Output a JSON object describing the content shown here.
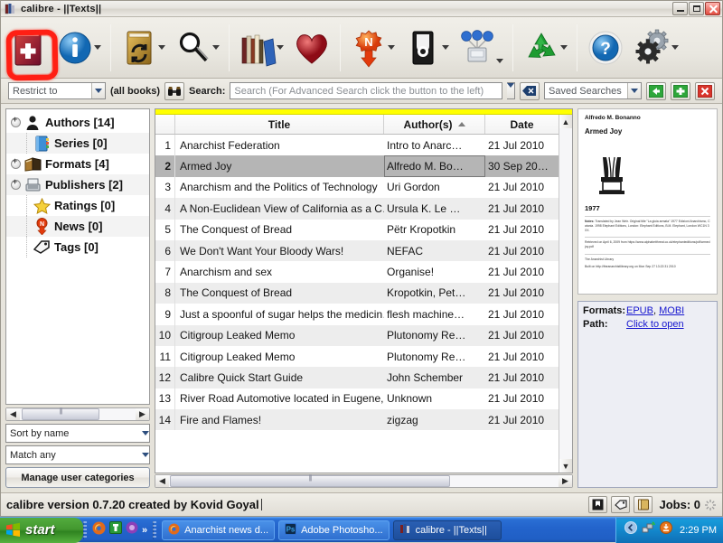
{
  "window": {
    "title": "calibre - ||Texts||",
    "icon": "calibre-books-icon",
    "controls": {
      "minimize": "Minimize",
      "restore": "Restore",
      "close": "Close"
    }
  },
  "toolbar": {
    "items": [
      {
        "name": "add-books-button",
        "icon": "book-plus-icon",
        "label": "Add books",
        "has_menu": false,
        "highlighted": true
      },
      {
        "name": "edit-metadata-button",
        "icon": "info-circle-icon",
        "label": "Edit metadata",
        "has_menu": true
      },
      {
        "name": "convert-books-button",
        "icon": "book-convert-icon",
        "label": "Convert books",
        "has_menu": true
      },
      {
        "name": "view-button",
        "icon": "magnifier-icon",
        "label": "View",
        "has_menu": true
      },
      {
        "name": "get-books-button",
        "icon": "bookshelf-icon",
        "label": "Get books",
        "has_menu": true
      },
      {
        "name": "donate-button",
        "icon": "heart-icon",
        "label": "Donate",
        "has_menu": false
      },
      {
        "name": "fetch-news-button",
        "icon": "news-pin-icon",
        "label": "Fetch news",
        "has_menu": true
      },
      {
        "name": "save-to-disk-button",
        "icon": "hard-disk-icon",
        "label": "Save to disk",
        "has_menu": true
      },
      {
        "name": "connect-share-button",
        "icon": "connect-share-icon",
        "label": "Connect/share",
        "has_menu": true
      },
      {
        "name": "remove-books-button",
        "icon": "recycle-icon",
        "label": "Remove books",
        "has_menu": true
      },
      {
        "name": "help-button",
        "icon": "question-circle-icon",
        "label": "Help",
        "has_menu": false
      },
      {
        "name": "preferences-button",
        "icon": "gears-icon",
        "label": "Preferences",
        "has_menu": true
      }
    ],
    "highlight_color": "#ff1f14"
  },
  "searchbar": {
    "restrict_label": "Restrict to",
    "restrict_value": "Restrict to",
    "all_books_label": "(all books)",
    "advanced_search_icon": "binoculars-icon",
    "search_label": "Search:",
    "search_value": "",
    "search_placeholder": "Search (For Advanced Search click the button to the left)",
    "clear_icon": "clear-search-icon",
    "saved_searches_value": "Saved Searches",
    "copy_search_icon": "green-left-arrow-icon",
    "add_search_icon": "green-plus-icon",
    "delete_search_icon": "red-x-icon"
  },
  "sidebar": {
    "items": [
      {
        "label": "Authors [14]",
        "icon": "person-icon",
        "expandable": true
      },
      {
        "label": "Series [0]",
        "icon": "notebook-icon",
        "expandable": false
      },
      {
        "label": "Formats [4]",
        "icon": "open-book-icon",
        "expandable": true
      },
      {
        "label": "Publishers [2]",
        "icon": "typewriter-icon",
        "expandable": true
      },
      {
        "label": "Ratings [0]",
        "icon": "star-icon",
        "expandable": false
      },
      {
        "label": "News [0]",
        "icon": "news-pin-icon",
        "expandable": false
      },
      {
        "label": "Tags [0]",
        "icon": "tag-icon",
        "expandable": false
      }
    ],
    "sort_value": "Sort by name",
    "match_value": "Match any",
    "manage_button": "Manage user categories"
  },
  "book_list": {
    "columns": [
      {
        "key": "num",
        "label": ""
      },
      {
        "key": "title",
        "label": "Title"
      },
      {
        "key": "author",
        "label": "Author(s)",
        "sorted": true,
        "sort_dir": "asc"
      },
      {
        "key": "date",
        "label": "Date"
      }
    ],
    "rows": [
      {
        "num": "1",
        "title": "Anarchist Federation",
        "author": "Intro to Anarc…",
        "date": "21 Jul 2010"
      },
      {
        "num": "2",
        "title": "Armed Joy",
        "author": "Alfredo M. Bo…",
        "date": "30 Sep 20…",
        "selected": true
      },
      {
        "num": "3",
        "title": "Anarchism and the Politics of Technology",
        "author": "Uri Gordon",
        "date": "21 Jul 2010"
      },
      {
        "num": "4",
        "title": "A Non-Euclidean View of California as a C…",
        "author": "Ursula K. Le …",
        "date": "21 Jul 2010"
      },
      {
        "num": "5",
        "title": "The Conquest of Bread",
        "author": "Pëtr Kropotkin",
        "date": "21 Jul 2010"
      },
      {
        "num": "6",
        "title": "We Don't Want Your Bloody Wars!",
        "author": "NEFAC",
        "date": "21 Jul 2010"
      },
      {
        "num": "7",
        "title": "Anarchism and sex",
        "author": "Organise!",
        "date": "21 Jul 2010"
      },
      {
        "num": "8",
        "title": "The Conquest of Bread",
        "author": "Kropotkin, Pet…",
        "date": "21 Jul 2010"
      },
      {
        "num": "9",
        "title": "Just a spoonful of sugar helps the medicin…",
        "author": "flesh machine…",
        "date": "21 Jul 2010"
      },
      {
        "num": "10",
        "title": "Citigroup Leaked Memo",
        "author": "Plutonomy Re…",
        "date": "21 Jul 2010"
      },
      {
        "num": "11",
        "title": "Citigroup Leaked Memo",
        "author": "Plutonomy Re…",
        "date": "21 Jul 2010"
      },
      {
        "num": "12",
        "title": "Calibre Quick Start Guide",
        "author": "John Schember",
        "date": "21 Jul 2010"
      },
      {
        "num": "13",
        "title": "River Road Automotive located in Eugene, …",
        "author": "Unknown",
        "date": "21 Jul 2010"
      },
      {
        "num": "14",
        "title": "Fire and Flames!",
        "author": "zigzag",
        "date": "21 Jul 2010"
      }
    ]
  },
  "details": {
    "cover": {
      "author": "Alfredo M. Bonanno",
      "title": "Armed Joy",
      "year": "1977",
      "notes_key": "Notes:",
      "notes": "Translated by Jean Weir. Original title \"La gioia armata\" 1977 Edizioni Anarchismo, Catania. 1998 Elephant Editions, London: Elephant Editions, B.M. Elephant, London WC1N 3XX.",
      "retrieved": "Retrieved on April 6, 2009 from https://www.alphabetthreat.co.uk/elephanteditions/pdf/armedjoy.pdf",
      "library": "The Anarchist Library",
      "built": "Built on http://theanarchistlibrary.org on Mon Sep 27 13:22:31 2010"
    },
    "formats_label": "Formats:",
    "formats": [
      "EPUB",
      "MOBI"
    ],
    "formats_separator": ", ",
    "path_label": "Path:",
    "path_link": "Click to open"
  },
  "statusbar": {
    "version_text": "calibre version 0.7.20 created by Kovid Goyal",
    "buttons": [
      {
        "name": "cover-browser-button",
        "icon": "cover-flow-icon"
      },
      {
        "name": "tag-browser-button",
        "icon": "tag-icon"
      },
      {
        "name": "book-details-button",
        "icon": "book-icon"
      }
    ],
    "jobs_label": "Jobs: 0",
    "spinner_icon": "spinner-icon"
  },
  "taskbar": {
    "start_label": "start",
    "quicklaunch": [
      {
        "name": "firefox-quicklaunch-icon",
        "icon": "firefox-icon"
      },
      {
        "name": "green-app-quicklaunch-icon",
        "icon": "green-square-icon"
      },
      {
        "name": "purple-app-quicklaunch-icon",
        "icon": "purple-circle-icon"
      },
      {
        "name": "more-quicklaunch-icon",
        "icon": "chevron-right-icon"
      }
    ],
    "tasks": [
      {
        "label": "Anarchist news d...",
        "icon": "firefox-icon",
        "active": false
      },
      {
        "label": "Adobe Photosho...",
        "icon": "photoshop-icon",
        "active": false
      },
      {
        "label": "calibre - ||Texts||",
        "icon": "calibre-books-icon",
        "active": true
      }
    ],
    "tray": [
      {
        "name": "show-hidden-icons-icon",
        "icon": "chevron-left-icon"
      },
      {
        "name": "network-icon",
        "icon": "network-icon"
      },
      {
        "name": "update-icon",
        "icon": "orange-circle-icon"
      }
    ],
    "clock": "2:29 PM"
  }
}
